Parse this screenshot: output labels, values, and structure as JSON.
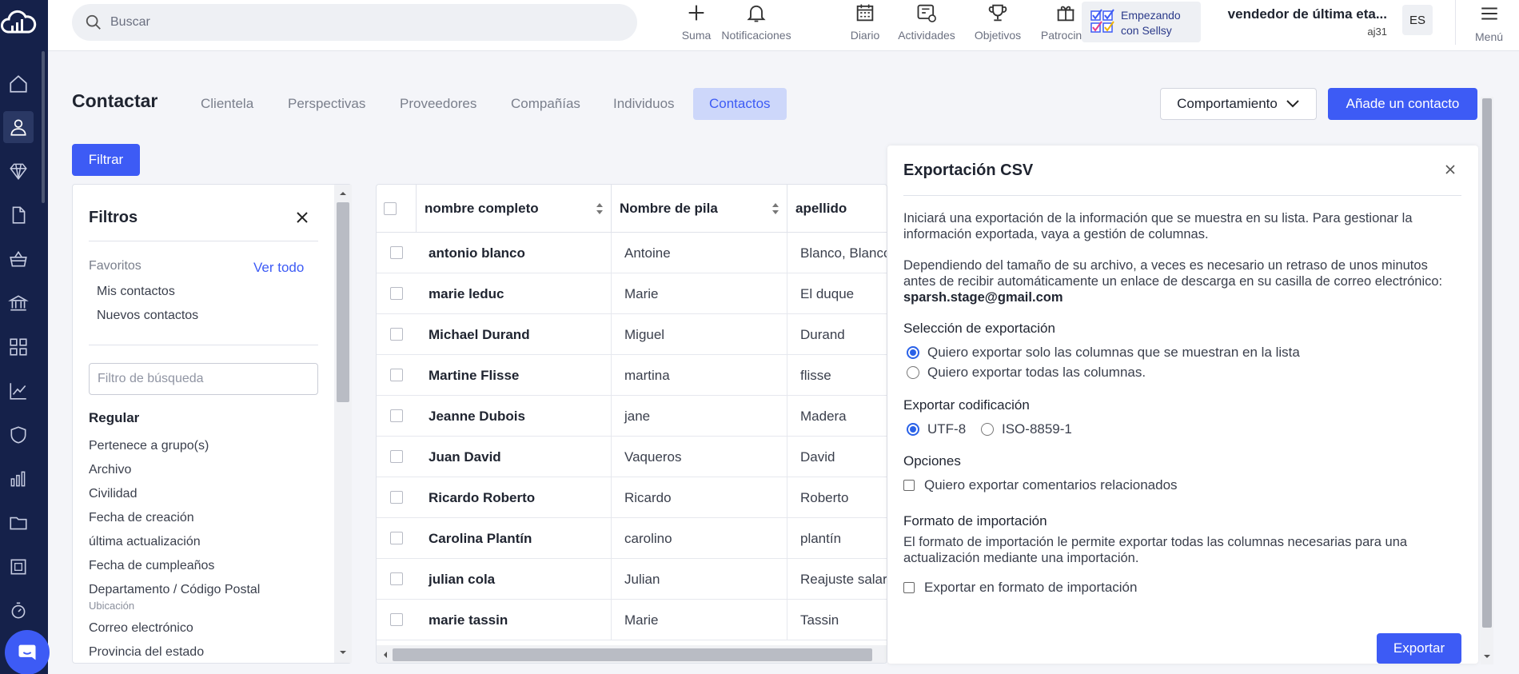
{
  "rail": {
    "items": [
      {
        "name": "home-icon",
        "active": false
      },
      {
        "name": "contacts-icon",
        "active": true
      },
      {
        "name": "diamond-icon",
        "active": false
      },
      {
        "name": "document-icon",
        "active": false
      },
      {
        "name": "basket-icon",
        "active": false
      },
      {
        "name": "bank-icon",
        "active": false
      },
      {
        "name": "grid-icon",
        "active": false
      },
      {
        "name": "chart-line-icon",
        "active": false
      },
      {
        "name": "shield-icon",
        "active": false
      },
      {
        "name": "bar-chart-icon",
        "active": false
      },
      {
        "name": "folder-icon",
        "active": false
      },
      {
        "name": "stamp-icon",
        "active": false
      },
      {
        "name": "stopwatch-icon",
        "active": false
      }
    ]
  },
  "search": {
    "placeholder": "Buscar"
  },
  "toolbar": {
    "items": [
      {
        "label": "Suma",
        "icon": "plus-icon"
      },
      {
        "label": "Notificaciones",
        "icon": "bell-icon"
      },
      {
        "label": "Diario",
        "icon": "calendar-icon"
      },
      {
        "label": "Actividades",
        "icon": "activities-icon"
      },
      {
        "label": "Objetivos",
        "icon": "trophy-icon"
      },
      {
        "label": "Patrocinio",
        "icon": "gift-icon"
      }
    ]
  },
  "promo": {
    "line1": "Empezando",
    "line2": "con Sellsy"
  },
  "account": {
    "name": "vendedor de última eta...",
    "user": "aj31",
    "lang": "ES",
    "menu": "Menú"
  },
  "page": {
    "title": "Contactar",
    "tabs": [
      "Clientela",
      "Perspectivas",
      "Proveedores",
      "Compañías",
      "Individuos",
      "Contactos"
    ],
    "active_tab": "Contactos",
    "behavior_btn": "Comportamiento",
    "add_btn": "Añade un contacto",
    "filter_btn": "Filtrar"
  },
  "filters": {
    "title": "Filtros",
    "favorites_label": "Favoritos",
    "see_all": "Ver todo",
    "favorites": [
      "Mis contactos",
      "Nuevos contactos"
    ],
    "search_placeholder": "Filtro de búsqueda",
    "section": "Regular",
    "items": [
      "Pertenece a grupo(s)",
      "Archivo",
      "Civilidad",
      "Fecha de creación",
      "última actualización",
      "Fecha de cumpleaños",
      "Departamento / Código Postal",
      "Correo electrónico",
      "Provincia del estado"
    ],
    "location_sub": "Ubicación"
  },
  "table": {
    "columns": [
      "nombre completo",
      "Nombre de pila",
      "apellido"
    ],
    "rows": [
      {
        "full": "antonio blanco",
        "first": "Antoine",
        "last": "Blanco, Blanco"
      },
      {
        "full": "marie leduc",
        "first": "Marie",
        "last": "El duque"
      },
      {
        "full": "Michael Durand",
        "first": "Miguel",
        "last": "Durand"
      },
      {
        "full": "Martine Flisse",
        "first": "martina",
        "last": "flisse"
      },
      {
        "full": "Jeanne Dubois",
        "first": "jane",
        "last": "Madera"
      },
      {
        "full": "Juan David",
        "first": "Vaqueros",
        "last": "David"
      },
      {
        "full": "Ricardo Roberto",
        "first": "Ricardo",
        "last": "Roberto"
      },
      {
        "full": "Carolina Plantín",
        "first": "carolino",
        "last": "plantín"
      },
      {
        "full": "julian cola",
        "first": "Julian",
        "last": "Reajuste salarial"
      },
      {
        "full": "marie tassin",
        "first": "Marie",
        "last": "Tassin"
      }
    ]
  },
  "csv": {
    "title": "Exportación CSV",
    "intro": "Iniciará una exportación de la información que se muestra en su lista. Para gestionar la información exportada, vaya a gestión de columnas.",
    "delay": "Dependiendo del tamaño de su archivo, a veces es necesario un retraso de unos minutos antes de recibir automáticamente un enlace de descarga en su casilla de correo electrónico:",
    "email": "sparsh.stage@gmail.com",
    "selection_label": "Selección de exportación",
    "opt_visible": "Quiero exportar solo las columnas que se muestran en la lista",
    "opt_all": "Quiero exportar todas las columnas.",
    "encoding_label": "Exportar codificación",
    "enc_utf8": "UTF-8",
    "enc_iso": "ISO-8859-1",
    "options_label": "Opciones",
    "opt_comments": "Quiero exportar comentarios relacionados",
    "import_label": "Formato de importación",
    "import_desc": "El formato de importación le permite exportar todas las columnas necesarias para una actualización mediante una importación.",
    "opt_import": "Exportar en formato de importación",
    "export_btn": "Exportar"
  }
}
